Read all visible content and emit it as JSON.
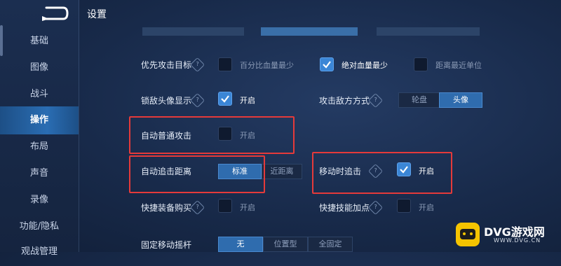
{
  "page": {
    "title": "设置"
  },
  "sidebar": {
    "items": [
      {
        "label": "基础"
      },
      {
        "label": "图像"
      },
      {
        "label": "战斗"
      },
      {
        "label": "操作"
      },
      {
        "label": "布局"
      },
      {
        "label": "声音"
      },
      {
        "label": "录像"
      },
      {
        "label": "功能/隐私"
      },
      {
        "label": "观战管理"
      }
    ],
    "active": "操作"
  },
  "settings": {
    "priority_target": {
      "label": "优先攻击目标",
      "options": [
        {
          "label": "百分比血量最少",
          "checked": false
        },
        {
          "label": "绝对血量最少",
          "checked": true
        },
        {
          "label": "距离最近单位",
          "checked": false
        }
      ]
    },
    "lock_avatar": {
      "label": "锁敌头像显示",
      "value_label": "开启",
      "checked": true
    },
    "attack_mode": {
      "label": "攻击敌方方式",
      "options": [
        "轮盘",
        "头像"
      ],
      "selected": "头像"
    },
    "auto_attack": {
      "label": "自动普通攻击",
      "value_label": "开启",
      "checked": false
    },
    "auto_chase": {
      "label": "自动追击距离",
      "options": [
        "标准",
        "近距离"
      ],
      "selected": "标准"
    },
    "move_chase": {
      "label": "移动时追击",
      "value_label": "开启",
      "checked": true
    },
    "quick_buy": {
      "label": "快捷装备购买",
      "value_label": "开启",
      "checked": false
    },
    "quick_skill": {
      "label": "快捷技能加点",
      "value_label": "开启",
      "checked": false
    },
    "fixed_joystick": {
      "label": "固定移动摇杆",
      "options": [
        "无",
        "位置型",
        "全固定"
      ],
      "selected": "无"
    }
  },
  "help_glyph": "?",
  "watermark": {
    "brand": "DVG游戏网",
    "url": "WWW.DVG.CN"
  },
  "colors": {
    "accent": "#3b86d6",
    "highlight_box": "#e53a3a",
    "active_tab": "#2a6db3"
  }
}
